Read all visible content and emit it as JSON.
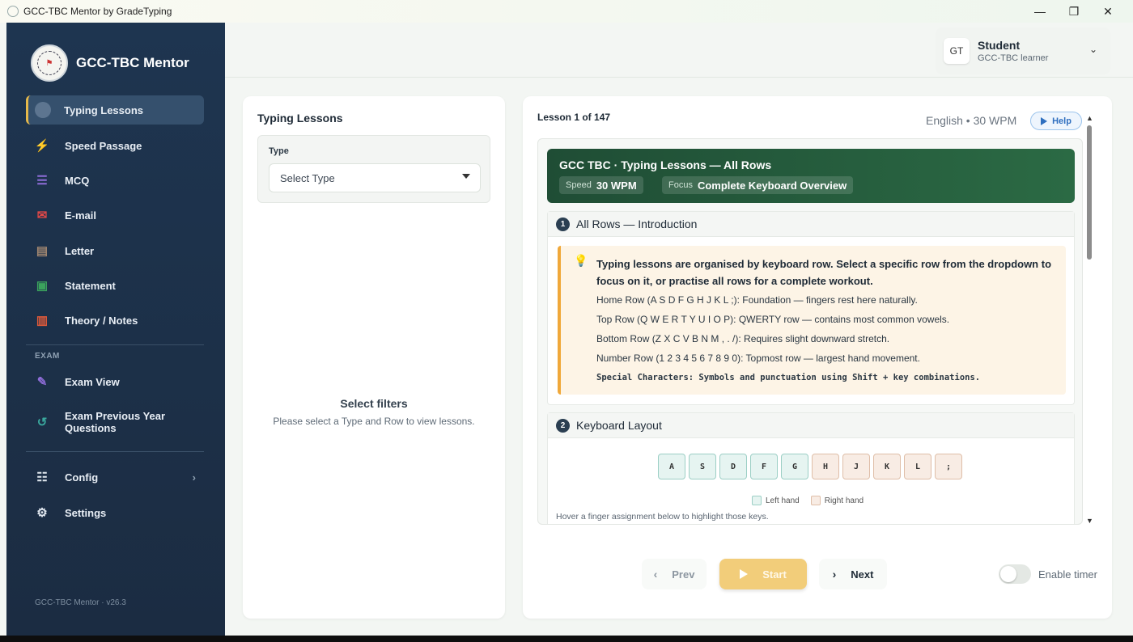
{
  "window": {
    "title": "GCC-TBC Mentor by GradeTyping",
    "controls": {
      "minimize": "—",
      "maximize": "❐",
      "close": "✕"
    }
  },
  "sidebar": {
    "brand": "GCC-TBC Mentor",
    "items": [
      {
        "label": "Typing Lessons",
        "icon": "keyboard-icon",
        "active": true
      },
      {
        "label": "Speed Passage",
        "icon": "lightning-icon",
        "color": "#f2c84b"
      },
      {
        "label": "MCQ",
        "icon": "list-icon",
        "color": "#8e6dd8"
      },
      {
        "label": "E-mail",
        "icon": "mail-icon",
        "color": "#e04848"
      },
      {
        "label": "Letter",
        "icon": "document-icon",
        "color": "#a08670"
      },
      {
        "label": "Statement",
        "icon": "excel-icon",
        "color": "#3ba35d"
      },
      {
        "label": "Theory / Notes",
        "icon": "book-icon",
        "color": "#e05a3a"
      }
    ],
    "exam_label": "EXAM",
    "exam_items": [
      {
        "label": "Exam View",
        "icon": "edit-icon",
        "color": "#8e6dd8"
      },
      {
        "label_line1": "Exam Previous Year",
        "label_line2": "Questions",
        "icon": "history-icon",
        "color": "#3aa89e"
      }
    ],
    "bottom_items": [
      {
        "label": "Config",
        "icon": "sliders-icon"
      },
      {
        "label": "Settings",
        "icon": "gear-icon"
      }
    ],
    "version": "GCC-TBC Mentor · v26.3"
  },
  "header": {
    "user": {
      "initials": "GT",
      "name": "Student",
      "role": "GCC-TBC learner"
    }
  },
  "left_panel": {
    "title": "Typing Lessons",
    "type_label": "Type",
    "type_select": "Select Type",
    "empty_title": "Select filters",
    "empty_sub": "Please select a Type and Row to view lessons."
  },
  "right_panel": {
    "lesson_count": "Lesson 1 of 147",
    "lang_speed": "English • 30 WPM",
    "help_label": "Help",
    "banner": {
      "title": "GCC TBC · Typing Lessons — All Rows",
      "speed_key": "Speed",
      "speed_val": "30 WPM",
      "focus_key": "Focus",
      "focus_val": "Complete Keyboard Overview"
    },
    "section1": {
      "num": "1",
      "title": "All Rows — Introduction",
      "lead": "Typing lessons are organised by keyboard row. Select a specific row from the dropdown to focus on it, or practise all rows for a complete workout.",
      "lines": [
        "Home Row (A S D F G H J K L ;): Foundation — fingers rest here naturally.",
        "Top Row (Q W E R T Y U I O P): QWERTY row — contains most common vowels.",
        "Bottom Row (Z X C V B N M , . /): Requires slight downward stretch.",
        "Number Row (1 2 3 4 5 6 7 8 9 0): Topmost row — largest hand movement."
      ],
      "mono_line": "Special Characters: Symbols and punctuation using Shift + key combinations."
    },
    "section2": {
      "num": "2",
      "title": "Keyboard Layout",
      "keys": [
        {
          "k": "A",
          "hand": "l"
        },
        {
          "k": "S",
          "hand": "l"
        },
        {
          "k": "D",
          "hand": "l"
        },
        {
          "k": "F",
          "hand": "l"
        },
        {
          "k": "G",
          "hand": "l"
        },
        {
          "k": "H",
          "hand": "r"
        },
        {
          "k": "J",
          "hand": "r"
        },
        {
          "k": "K",
          "hand": "r"
        },
        {
          "k": "L",
          "hand": "r"
        },
        {
          "k": ";",
          "hand": "r"
        }
      ],
      "legend_left": "Left hand",
      "legend_right": "Right hand",
      "hover_note": "Hover a finger assignment below to highlight those keys."
    }
  },
  "controls": {
    "prev": "Prev",
    "start": "Start",
    "next": "Next",
    "timer_label": "Enable timer",
    "timer_enabled": false
  }
}
